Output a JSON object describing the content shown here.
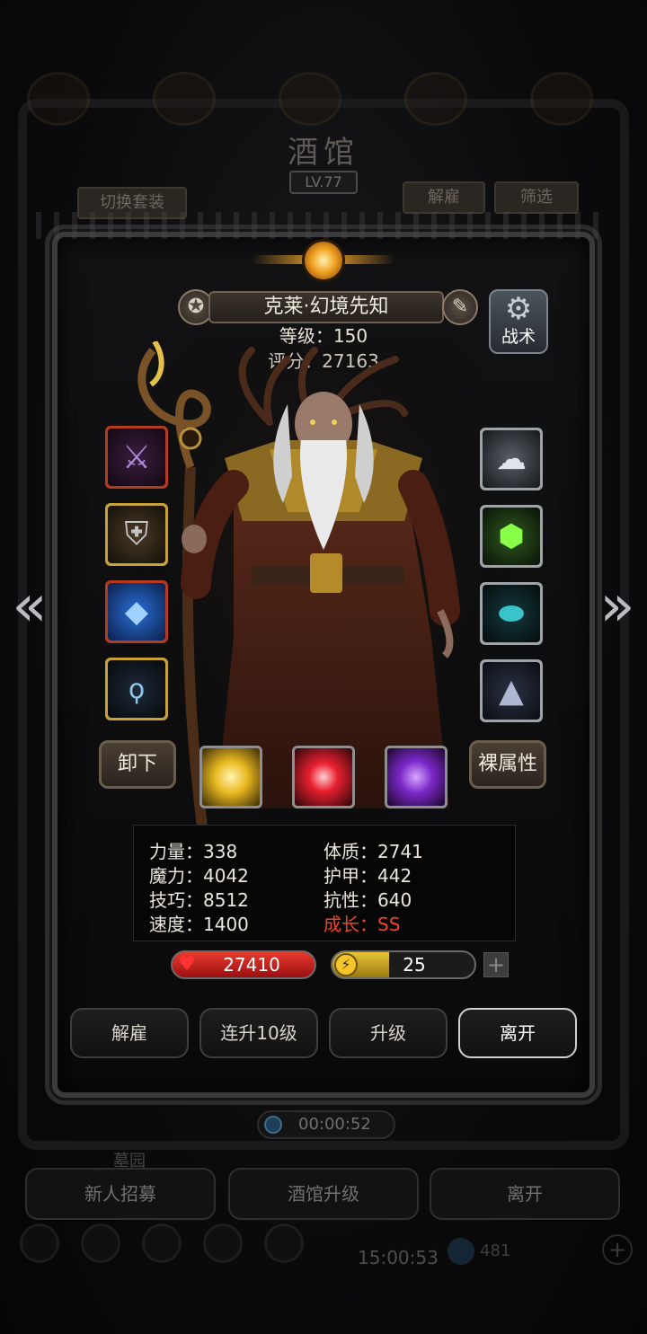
{
  "background": {
    "title": "酒馆",
    "level": "LV.77",
    "switch_outfit": "切换套装",
    "dismiss": "解雇",
    "filter": "筛选",
    "timer": "00:00:52",
    "area_label": "墓园",
    "recruit": "新人招募",
    "upgrade_tavern": "酒馆升级",
    "leave": "离开",
    "clock": "15:00:53",
    "gem_count": "481"
  },
  "hero": {
    "name": "克莱·幻境先知",
    "level_text": "等级：150",
    "score_text": "评分：27163",
    "tactics_label": "战术"
  },
  "buttons": {
    "unequip": "卸下",
    "base_attr": "裸属性",
    "prev": "«",
    "next": "»",
    "plus": "+"
  },
  "attributes": {
    "strength": "力量：338",
    "constitution": "体质：2741",
    "magic": "魔力：4042",
    "armor": "护甲：442",
    "skill": "技巧：8512",
    "resistance": "抗性：640",
    "speed": "速度：1400",
    "growth": "成长：SS"
  },
  "bars": {
    "hp": "27410",
    "energy": "25",
    "energy_fraction": 0.4
  },
  "actions": {
    "dismiss": "解雇",
    "level10": "连升10级",
    "upgrade": "升级",
    "leave": "离开"
  },
  "colors": {
    "growth": "#f0442c",
    "hp": "#d82a22",
    "energy": "#e3b92c"
  },
  "icons": {
    "left_slots": [
      "staff-icon",
      "armor-icon",
      "gem-icon",
      "necklace-icon"
    ],
    "right_slots": [
      "cloud-icon",
      "crystal-icon",
      "stone-icon",
      "pyramid-icon"
    ],
    "skills": [
      "light-burst-icon",
      "red-slash-icon",
      "purple-skull-icon"
    ]
  }
}
